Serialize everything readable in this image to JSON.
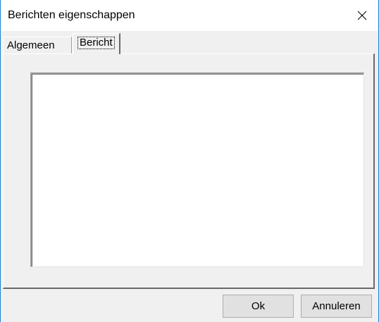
{
  "window": {
    "title": "Berichten eigenschappen",
    "close_icon": "close-icon"
  },
  "tabs": [
    {
      "label": "Algemeen",
      "selected": false
    },
    {
      "label": "Bericht",
      "selected": true
    }
  ],
  "message": {
    "value": ""
  },
  "buttons": {
    "ok_label": "Ok",
    "cancel_label": "Annuleren"
  },
  "colors": {
    "window_border": "#1883d7",
    "dialog_background": "#f0f0f0",
    "button_background": "#e1e1e1"
  }
}
